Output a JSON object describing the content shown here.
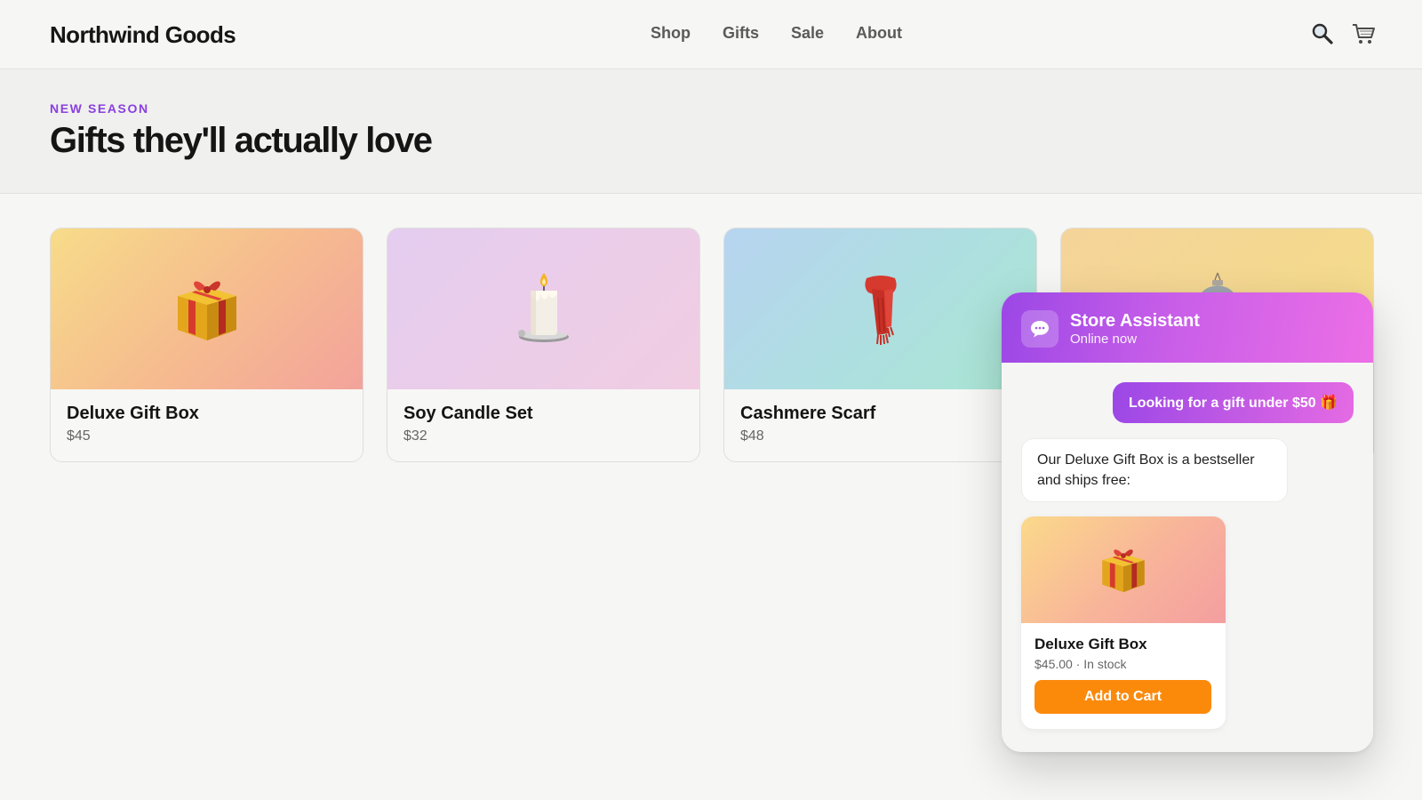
{
  "header": {
    "brand": "Northwind Goods",
    "nav": [
      "Shop",
      "Gifts",
      "Sale",
      "About"
    ],
    "icons": [
      "search-icon",
      "cart-icon"
    ]
  },
  "hero": {
    "eyebrow": "NEW SEASON",
    "title": "Gifts they'll actually love",
    "eyebrow_color": "#8a3fe0"
  },
  "products": [
    {
      "name": "Deluxe Gift Box",
      "price": "$45",
      "icon": "gift-icon",
      "gradient": [
        "#f7dc8a",
        "#f3a39b"
      ]
    },
    {
      "name": "Soy Candle Set",
      "price": "$32",
      "icon": "candle-icon",
      "gradient": [
        "#e4cdf0",
        "#f0cde2"
      ]
    },
    {
      "name": "Cashmere Scarf",
      "price": "$48",
      "icon": "scarf-icon",
      "gradient": [
        "#b7d4f0",
        "#a9e6d2"
      ]
    },
    {
      "name": "",
      "price": "",
      "icon": "ornament-icon",
      "gradient": [
        "#f5d49a",
        "#f3dc87"
      ]
    }
  ],
  "chat": {
    "title": "Store Assistant",
    "status": "Online now",
    "user_message": "Looking for a gift under $50 🎁",
    "bot_message": "Our Deluxe Gift Box is a bestseller and ships free:",
    "product": {
      "name": "Deluxe Gift Box",
      "meta": "$45.00 · In stock",
      "button": "Add to Cart"
    },
    "colors": {
      "accent_start": "#9b47e6",
      "accent_end": "#ec6fe6",
      "button": "#fb8a0b"
    }
  }
}
